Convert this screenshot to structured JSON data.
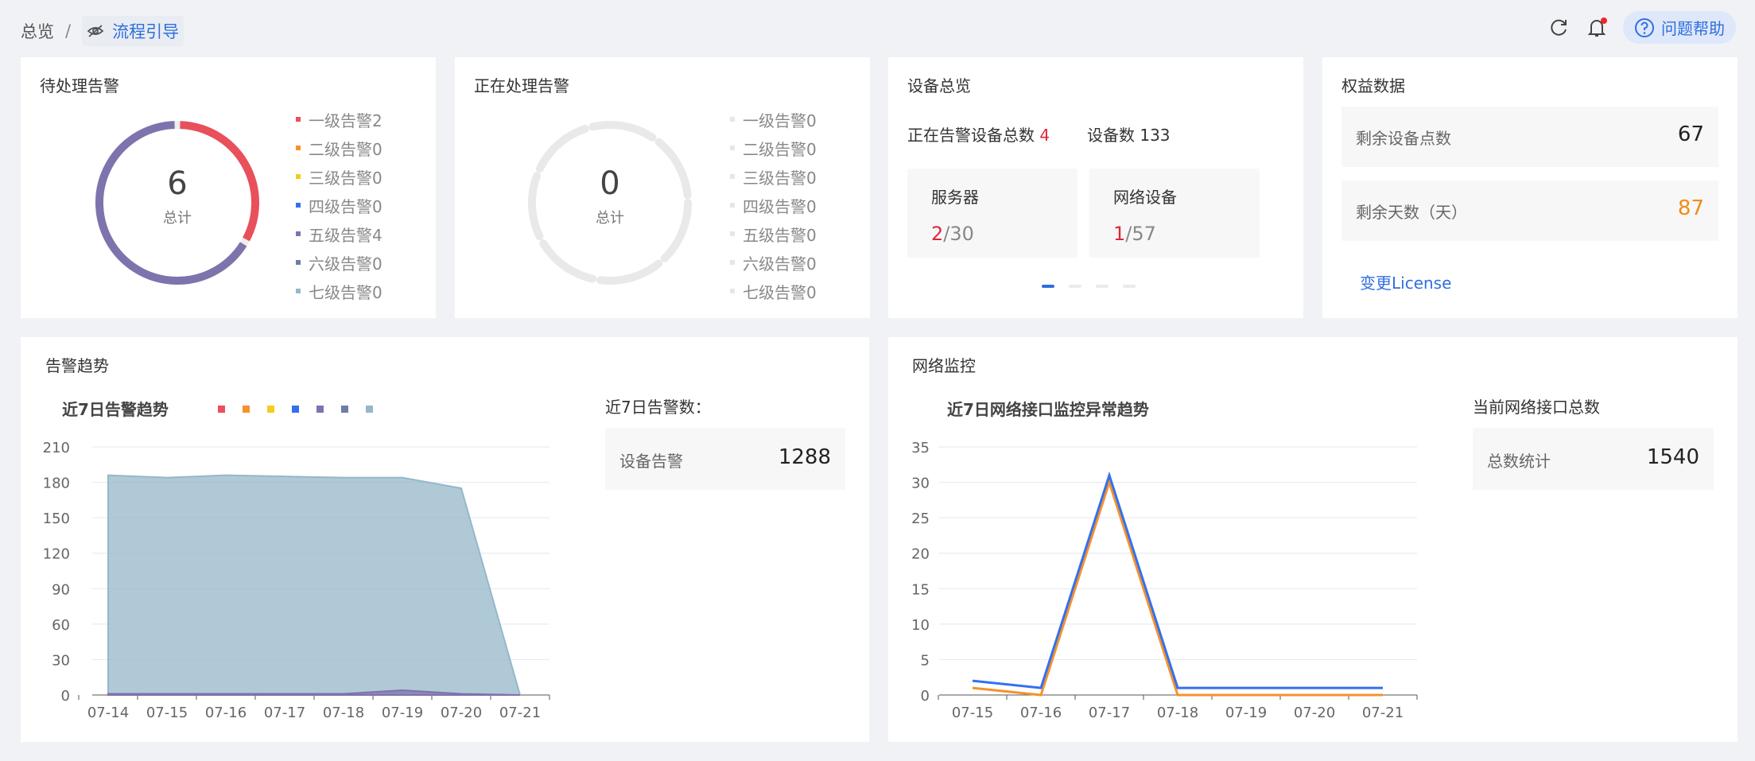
{
  "breadcrumb": {
    "root": "总览",
    "separator": "/",
    "current": "流程引导"
  },
  "toolbar": {
    "help_label": "问题帮助"
  },
  "pending": {
    "title": "待处理告警",
    "total": "6",
    "total_label": "总计",
    "legend": [
      {
        "label": "一级告警2",
        "color": "#e8505b"
      },
      {
        "label": "二级告警0",
        "color": "#f5922b"
      },
      {
        "label": "三级告警0",
        "color": "#f3cd1f"
      },
      {
        "label": "四级告警0",
        "color": "#3370f0"
      },
      {
        "label": "五级告警4",
        "color": "#7f73ad"
      },
      {
        "label": "六级告警0",
        "color": "#6e7ea5"
      },
      {
        "label": "七级告警0",
        "color": "#96b7c9"
      }
    ],
    "slices": [
      2,
      4
    ]
  },
  "processing": {
    "title": "正在处理告警",
    "total": "0",
    "total_label": "总计",
    "legend": [
      "一级告警0",
      "二级告警0",
      "三级告警0",
      "四级告警0",
      "五级告警0",
      "六级告警0",
      "七级告警0"
    ]
  },
  "devices": {
    "title": "设备总览",
    "alarm_label": "正在告警设备总数",
    "alarm_value": "4",
    "count_label": "设备数",
    "count_value": "133",
    "server": {
      "label": "服务器",
      "alarm": "2",
      "total": "/30"
    },
    "network": {
      "label": "网络设备",
      "alarm": "1",
      "total": "/57"
    },
    "pager_active": 0
  },
  "rights": {
    "title": "权益数据",
    "remain_points_label": "剩余设备点数",
    "remain_points_value": "67",
    "remain_days_label": "剩余天数（天）",
    "remain_days_value": "87",
    "license_link": "变更License"
  },
  "trend": {
    "title": "告警趋势",
    "side_title": "近7日告警数：",
    "side_label": "设备告警",
    "side_value": "1288"
  },
  "network": {
    "title": "网络监控",
    "side_title": "当前网络接口总数",
    "side_label": "总数统计",
    "side_value": "1540"
  },
  "chart_data": [
    {
      "type": "area",
      "title": "近7日告警趋势",
      "categories": [
        "07-14",
        "07-15",
        "07-16",
        "07-17",
        "07-18",
        "07-19",
        "07-20",
        "07-21"
      ],
      "ylim": [
        0,
        210
      ],
      "yticks": [
        0,
        30,
        60,
        90,
        120,
        150,
        180,
        210
      ],
      "legend_colors": [
        "#e8505b",
        "#f5922b",
        "#f3cd1f",
        "#3370f0",
        "#7f73ad",
        "#6e7ea5",
        "#96b7c9"
      ],
      "series": [
        {
          "color": "#7f73ad",
          "values": [
            1,
            1,
            1,
            1,
            1,
            4,
            1,
            0
          ]
        },
        {
          "color": "#96b7c9",
          "values": [
            186,
            184,
            186,
            185,
            184,
            184,
            175,
            0
          ]
        }
      ]
    },
    {
      "type": "line",
      "title": "近7日网络接口监控异常趋势",
      "categories": [
        "07-15",
        "07-16",
        "07-17",
        "07-18",
        "07-19",
        "07-20",
        "07-21"
      ],
      "ylim": [
        0,
        35
      ],
      "yticks": [
        0,
        5,
        10,
        15,
        20,
        25,
        30,
        35
      ],
      "series": [
        {
          "color": "#f5922b",
          "values": [
            1,
            0,
            30,
            0,
            0,
            0,
            0
          ]
        },
        {
          "color": "#3370f0",
          "values": [
            2,
            1,
            31,
            1,
            1,
            1,
            1
          ]
        }
      ]
    }
  ]
}
